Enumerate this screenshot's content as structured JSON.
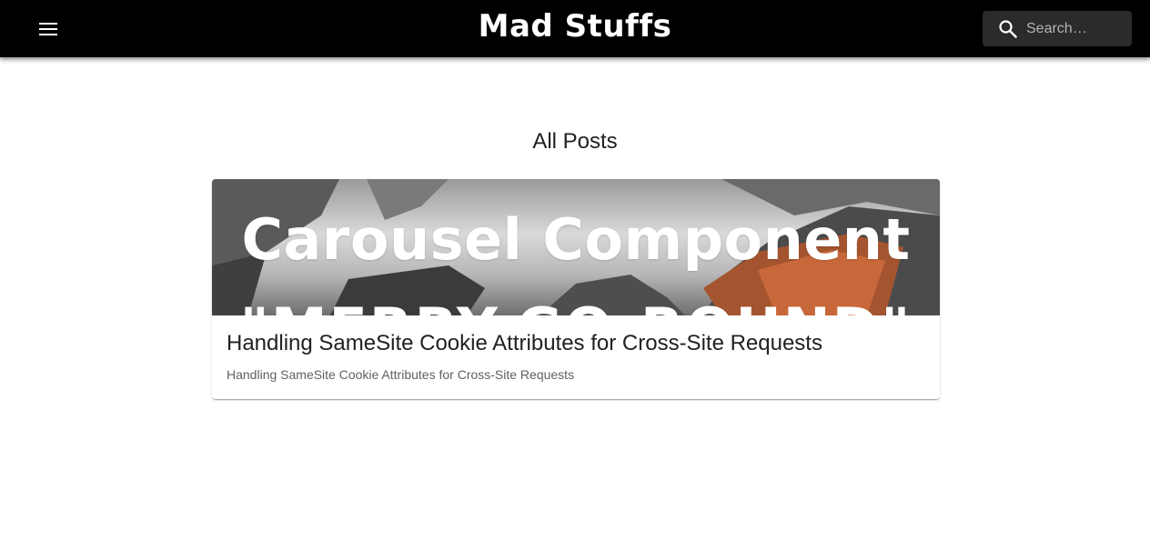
{
  "header": {
    "brand": "Mad Stuffs",
    "menu_icon": "menu-icon",
    "search": {
      "icon": "search-icon",
      "placeholder": "Search…",
      "value": ""
    },
    "background": "#000000"
  },
  "main": {
    "title": "All Posts",
    "posts": [
      {
        "image_text_line1": "Carousel Component",
        "image_text_line2": "\"MERRY-GO-ROUND\"",
        "title": "Handling SameSite Cookie Attributes for Cross-Site Requests",
        "description": "Handling SameSite Cookie Attributes for Cross-Site Requests"
      }
    ]
  }
}
